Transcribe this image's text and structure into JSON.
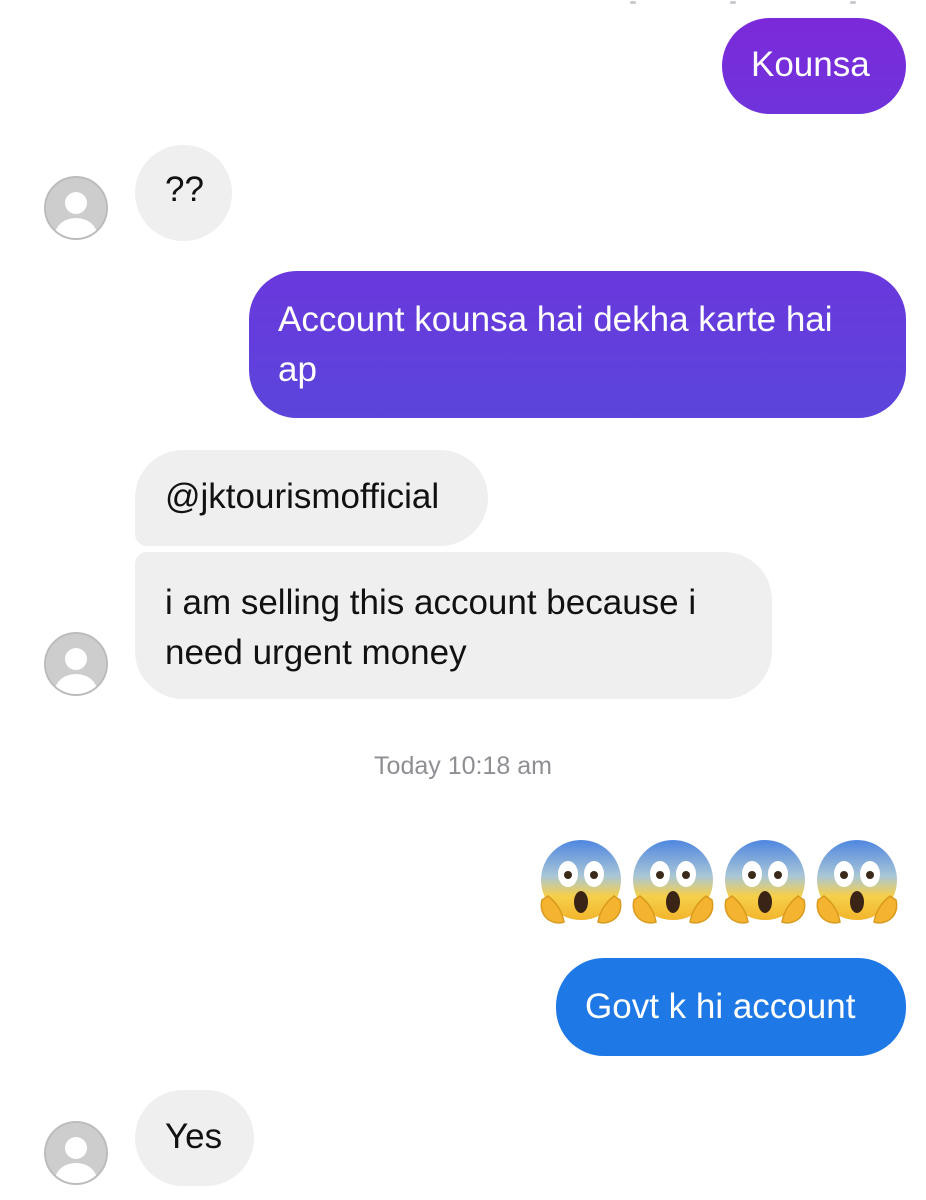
{
  "conversation": {
    "messages": [
      {
        "id": "m1",
        "direction": "outgoing",
        "text": "Kounsa"
      },
      {
        "id": "m2",
        "direction": "incoming",
        "text": "??"
      },
      {
        "id": "m3",
        "direction": "outgoing",
        "lines": [
          "Account kounsa hai dekha karte hai",
          "ap"
        ]
      },
      {
        "id": "m4",
        "direction": "incoming",
        "text": "@jktourismofficial"
      },
      {
        "id": "m5",
        "direction": "incoming",
        "lines": [
          "i am selling this account because i",
          "need urgent money"
        ]
      },
      {
        "id": "m6",
        "direction": "outgoing",
        "emoji": [
          "face-screaming-in-fear",
          "face-screaming-in-fear",
          "face-screaming-in-fear",
          "face-screaming-in-fear"
        ]
      },
      {
        "id": "m7",
        "direction": "outgoing",
        "text": "Govt k hi account"
      },
      {
        "id": "m8",
        "direction": "incoming",
        "text": "Yes"
      }
    ],
    "timestamp": "Today 10:18 am"
  },
  "colors": {
    "outgoing_gradient_top": "#7C2AD9",
    "outgoing_gradient_mid": "#6E35DE",
    "outgoing_gradient_low": "#5B45DB",
    "outgoing_blue": "#1E78E6",
    "incoming_bg": "#EFEFEF",
    "timestamp": "#8E8E93",
    "avatar_bg": "#CDCDCD"
  },
  "icons": {
    "avatar": "default-profile-avatar-icon",
    "emoji": "face-screaming-in-fear-emoji"
  }
}
